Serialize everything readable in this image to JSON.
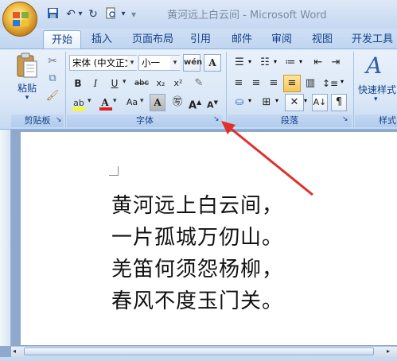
{
  "window": {
    "title": "黄河远上白云间 - Microsoft Word"
  },
  "quick_access": {
    "dropdown_glyph": "▾"
  },
  "tabs": [
    {
      "label": "开始",
      "active": true
    },
    {
      "label": "插入"
    },
    {
      "label": "页面布局"
    },
    {
      "label": "引用"
    },
    {
      "label": "邮件"
    },
    {
      "label": "审阅"
    },
    {
      "label": "视图"
    },
    {
      "label": "开发工具"
    }
  ],
  "clipboard": {
    "paste_label": "粘贴",
    "group_label": "剪贴板"
  },
  "font": {
    "family": "宋体 (中文正文)",
    "size": "小一",
    "group_label": "字体",
    "buttons": {
      "bold": "B",
      "italic": "I",
      "underline": "U",
      "strike": "abc",
      "subscript": "x₂",
      "superscript": "x²",
      "grow": "A",
      "shrink": "A"
    }
  },
  "paragraph": {
    "group_label": "段落"
  },
  "styles": {
    "quick_styles_label": "快速样式",
    "group_label": "样式"
  },
  "document": {
    "lines": [
      "黄河远上白云间，",
      "一片孤城万仞山。",
      "羌笛何须怨杨柳，",
      "春风不度玉门关。"
    ]
  },
  "colors": {
    "annotation_arrow": "#e0302a",
    "font_color_bar": "#e02020",
    "highlight_bar": "#ffff00"
  }
}
